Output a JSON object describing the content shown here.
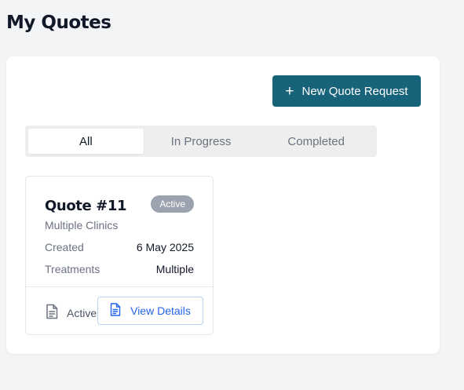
{
  "page": {
    "title": "My Quotes"
  },
  "toolbar": {
    "new_quote_label": "New Quote Request",
    "plus_icon": "+"
  },
  "tabs": [
    {
      "label": "All",
      "active": true
    },
    {
      "label": "In Progress",
      "active": false
    },
    {
      "label": "Completed",
      "active": false
    }
  ],
  "quotes": [
    {
      "title": "Quote #11",
      "status": "Active",
      "clinic": "Multiple Clinics",
      "created_label": "Created",
      "created_value": "6 May 2025",
      "treatments_label": "Treatments",
      "treatments_value": "Multiple",
      "footer_status": "Active",
      "view_label": "View Details"
    }
  ],
  "colors": {
    "primary": "#17637a",
    "link": "#2563eb",
    "badge": "#9ca3af",
    "background": "#f3f4f6"
  },
  "icons": {
    "document": "document-icon",
    "plus": "plus-icon"
  }
}
